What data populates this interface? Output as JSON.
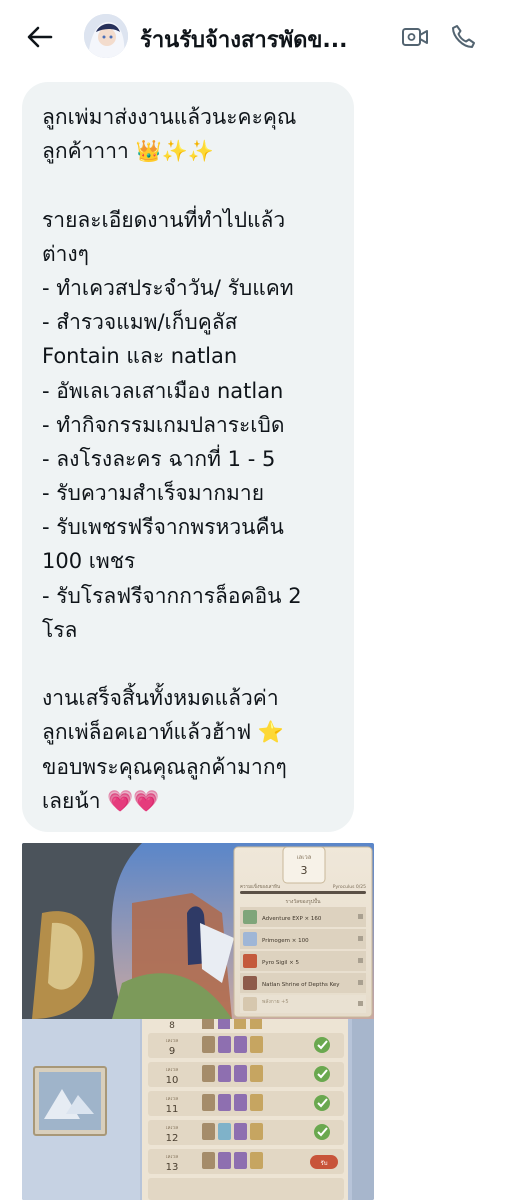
{
  "header": {
    "back_icon": "arrow-left-icon",
    "title": "ร้านรับจ้างสารพัดข...",
    "video_icon": "video-camera-icon",
    "call_icon": "phone-icon"
  },
  "message": {
    "lines": [
      "ลูกเพ่มาส่งงานแล้วนะคะคุณ",
      "ลูกค้าาาา 👑✨✨",
      "",
      "รายละเอียดงานที่ทำไปแล้ว",
      "ต่างๆ",
      "- ทำเควสประจำวัน/ รับแคท",
      "- สำรวจแมพ/เก็บคูลัส",
      "Fontain และ natlan",
      "- อัพเลเวลเสาเมือง natlan",
      "- ทำกิจกรรมเกมปลาระเบิด",
      "- ลงโรงละคร ฉากที่ 1 - 5",
      "- รับความสำเร็จมากมาย",
      "- รับเพชรฟรีจากพรหวนคืน",
      "100 เพชร",
      "- รับโรลฟรีจากการล็อคอิน 2",
      "โรล",
      "",
      "งานเสร็จสิ้นทั้งหมดแล้วค่า",
      "ลูกเพ่ล็อคเอาท์แล้วฮ้าฟ ⭐",
      "ขอบพระคุณคุณลูกค้ามากๆ",
      "เลยน้า 💗💗"
    ]
  },
  "screenshot_top": {
    "level_label": "เลเวล",
    "level_value": "3",
    "progress_label": "ความแข็งของเสาหิน",
    "progress_text": "Pyroculus 0/25",
    "rewards_header": "รางวัลของรูปปั้น",
    "rewards": [
      "Adventure EXP × 160",
      "Primogem × 100",
      "Pyro Sigil × 5",
      "Natlan Shrine of Depths Key"
    ],
    "extra_label": "พลังกาย +5"
  },
  "screenshot_bottom": {
    "level_label": "เลเวล",
    "levels": [
      "8",
      "9",
      "10",
      "11",
      "12",
      "13"
    ],
    "claim_label": "รับ"
  }
}
